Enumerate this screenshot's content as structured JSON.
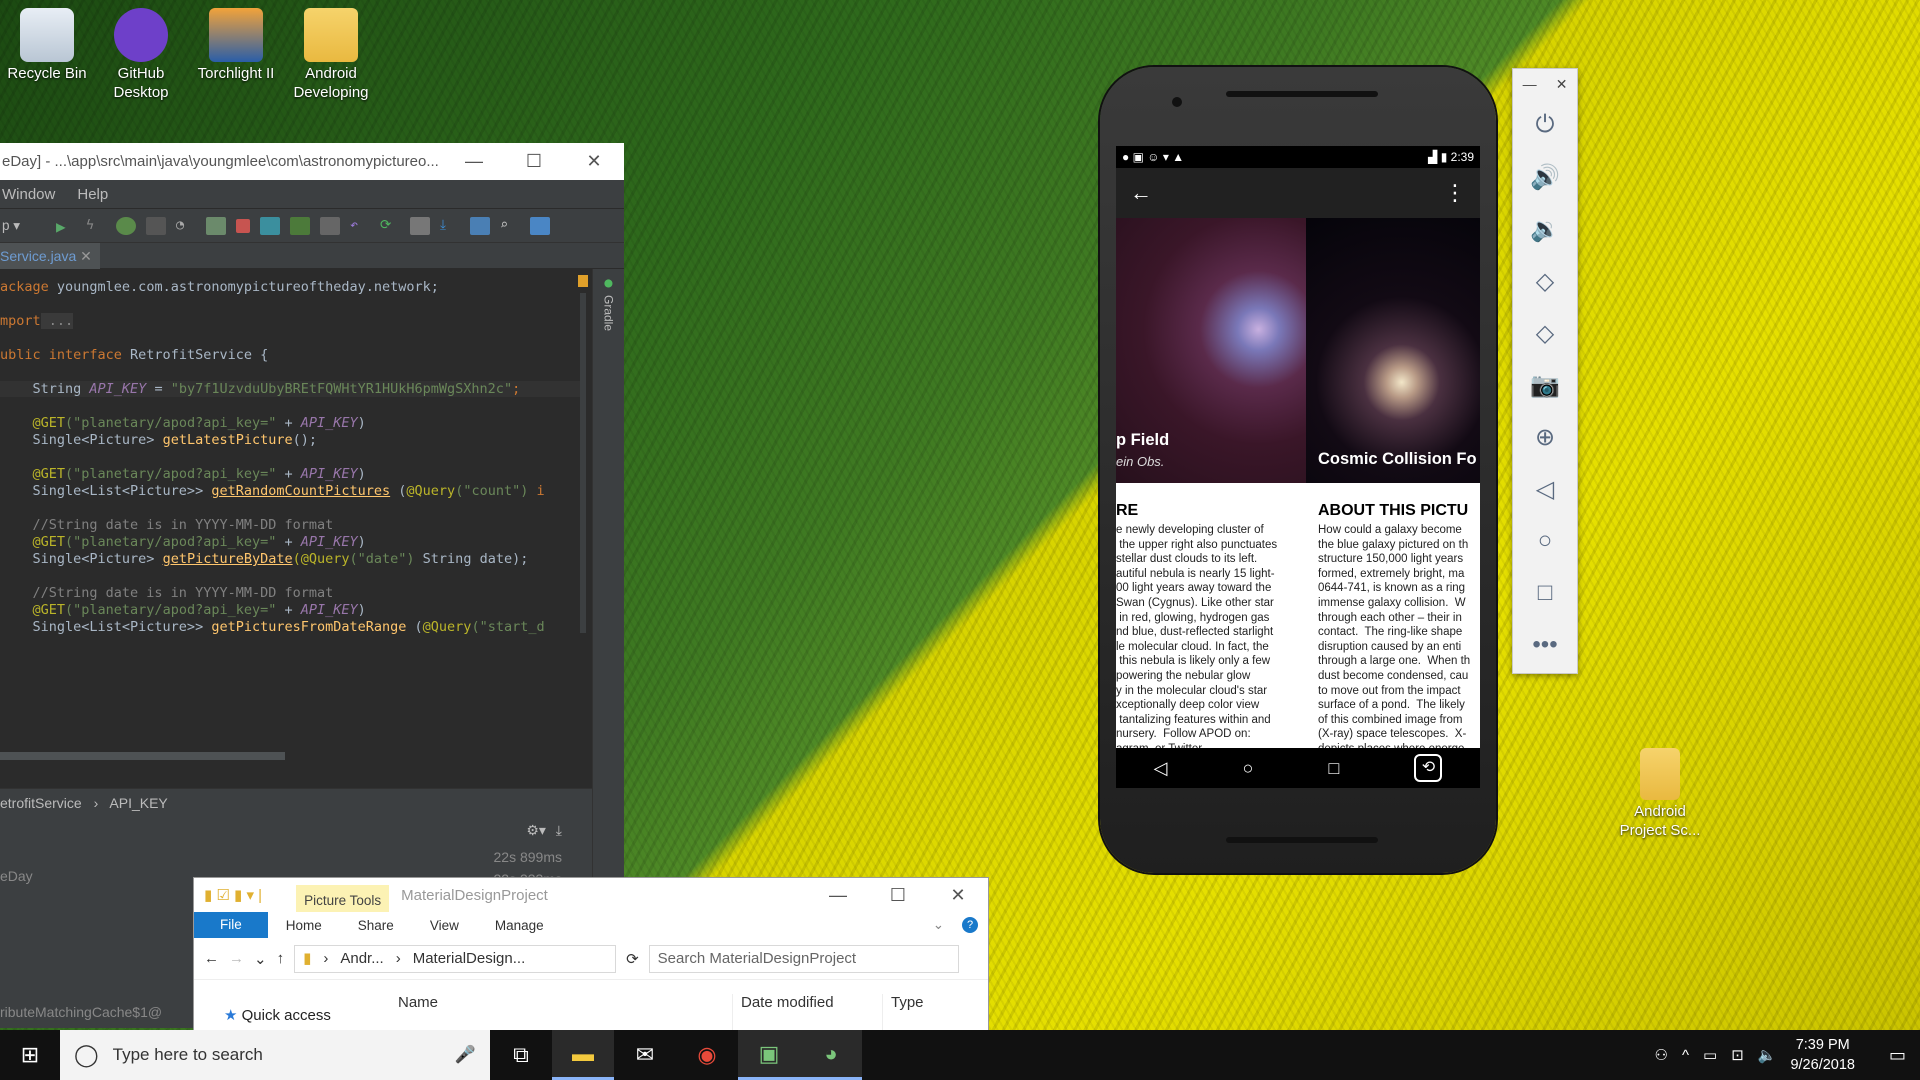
{
  "desktop": {
    "icons": [
      {
        "label_1": "Recycle Bin",
        "label_2": ""
      },
      {
        "label_1": "GitHub",
        "label_2": "Desktop"
      },
      {
        "label_1": "Torchlight II",
        "label_2": ""
      },
      {
        "label_1": "Android",
        "label_2": "Developing"
      }
    ],
    "folder_icon": {
      "label_1": "Android",
      "label_2": "Project Sc..."
    }
  },
  "ide": {
    "title": "eDay] - ...\\app\\src\\main\\java\\youngmlee\\com\\astronomypictureo...",
    "menu": [
      "Window",
      "Help"
    ],
    "run_config": "p",
    "tab_label": "Service.java",
    "gradle_label": "Gradle",
    "code": {
      "l1_kw": "ackage",
      "l1_rest": " youngmlee.com.astronomypictureoftheday.network;",
      "l2_kw": "mport",
      "l2_rest": " ...",
      "l3_kw": "ublic interface",
      "l3_rest": " RetrofitService {",
      "l4_type": "    String ",
      "l4_const": "API_KEY",
      "l4_eq": " = ",
      "l4_str": "\"by7f1UzvduUbyBREtFQWHtYR1HUkH6pmWgSXhn2c\"",
      "l4_end": ";",
      "l5_ann": "    @GET",
      "l5_str": "(\"planetary/apod?api_key=\"",
      "l5_plus": " + ",
      "l5_const": "API_KEY",
      "l5_end": ")",
      "l6_type": "    Single<Picture> ",
      "l6_fn": "getLatestPicture",
      "l6_end": "();",
      "l7_ann": "    @GET",
      "l7_str": "(\"planetary/apod?api_key=\"",
      "l7_plus": " + ",
      "l7_const": "API_KEY",
      "l7_end": ")",
      "l8_type": "    Single<List<Picture>> ",
      "l8_fn": "getRandomCountPictures",
      "l8_mid": " (",
      "l8_ann": "@Query",
      "l8_str": "(\"count\")",
      "l8_end": " i",
      "l9_cm": "    //String date is in YYYY-MM-DD format",
      "l10_ann": "    @GET",
      "l10_str": "(\"planetary/apod?api_key=\"",
      "l10_plus": " + ",
      "l10_const": "API_KEY",
      "l10_end": ")",
      "l11_type": "    Single<Picture> ",
      "l11_fn": "getPictureByDate",
      "l11_ann": "(@Query",
      "l11_str": "(\"date\")",
      "l11_end": " String date);",
      "l12_cm": "    //String date is in YYYY-MM-DD format",
      "l13_ann": "    @GET",
      "l13_str": "(\"planetary/apod?api_key=\"",
      "l13_plus": " + ",
      "l13_const": "API_KEY",
      "l13_end": ")",
      "l14_type": "    Single<List<Picture>> ",
      "l14_fn": "getPicturesFromDateRange",
      "l14_mid": " (",
      "l14_ann": "@Query",
      "l14_str": "(\"start_d"
    },
    "breadcrumb": {
      "item_1": "etrofitService",
      "sep": "›",
      "item_2": "API_KEY"
    },
    "run": {
      "time_1": "22s 899ms",
      "time_2": "22s 333ms",
      "label_1": "eDay",
      "label_2": "ributeMatchingCache$1@"
    }
  },
  "phone": {
    "status_time": "2:39",
    "cards": [
      {
        "title": "p Field",
        "subtitle": "ein Obs.",
        "heading": "RE",
        "text": "e newly developing cluster of\n the upper right also punctuates\nstellar dust clouds to its left.\nautiful nebula is nearly 15 light-\n00 light years away toward the\nSwan (Cygnus). Like other star\n in red, glowing, hydrogen gas\nnd blue, dust-reflected starlight\nle molecular cloud. In fact, the\n this nebula is likely only a few\npowering the nebular glow\ny in the molecular cloud's star\nxceptionally deep color view\n tantalizing features within and\nnursery.  Follow APOD on:\nagram, or Twitter"
      },
      {
        "title": "Cosmic Collision Fo",
        "subtitle": "",
        "heading": "ABOUT THIS PICTU",
        "text": "How could a galaxy become\nthe blue galaxy pictured on th\nstructure 150,000 light years\nformed, extremely bright, ma\n0644-741, is known as a ring\nimmense galaxy collision.  W\nthrough each other – their in\ncontact.  The ring-like shape\ndisruption caused by an enti\nthrough a large one.  When th\ndust become condensed, cau\nto move out from the impact\nsurface of a pond.  The likely\nof this combined image from\n(X-ray) space telescopes.  X-\ndepicts places where energe"
      }
    ]
  },
  "explorer": {
    "ribbon_context": "Picture Tools",
    "title": "MaterialDesignProject",
    "tabs": [
      "File",
      "Home",
      "Share",
      "View",
      "Manage"
    ],
    "path_1": "Andr...",
    "path_2": "MaterialDesign...",
    "search_placeholder": "Search MaterialDesignProject",
    "columns": [
      "Name",
      "Date modified",
      "Type"
    ],
    "quick_access": "Quick access"
  },
  "taskbar": {
    "search_placeholder": "Type here to search",
    "time": "7:39 PM",
    "date": "9/26/2018"
  },
  "colors": {
    "accent": "#0078d7",
    "ide_bg": "#2b2b2b",
    "keyword": "#cc7832",
    "string": "#6a8759"
  }
}
